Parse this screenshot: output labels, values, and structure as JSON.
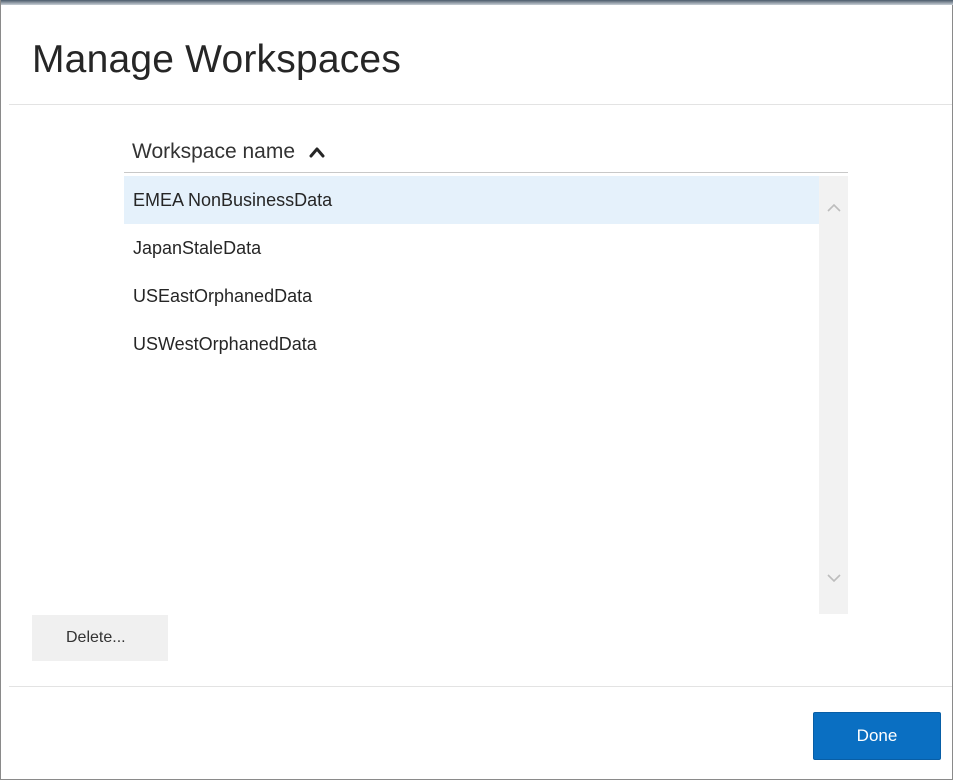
{
  "dialog": {
    "title": "Manage Workspaces"
  },
  "list": {
    "column_header": "Workspace name",
    "sort_icon": "chevron-up-icon",
    "items": [
      {
        "label": "EMEA NonBusinessData",
        "selected": true
      },
      {
        "label": "JapanStaleData",
        "selected": false
      },
      {
        "label": "USEastOrphanedData",
        "selected": false
      },
      {
        "label": "USWestOrphanedData",
        "selected": false
      }
    ],
    "selection_color": "#e5f1fb"
  },
  "buttons": {
    "delete_label": "Delete...",
    "done_label": "Done"
  },
  "colors": {
    "primary": "#0a6fc2",
    "secondary_button": "#f0f0f0"
  }
}
